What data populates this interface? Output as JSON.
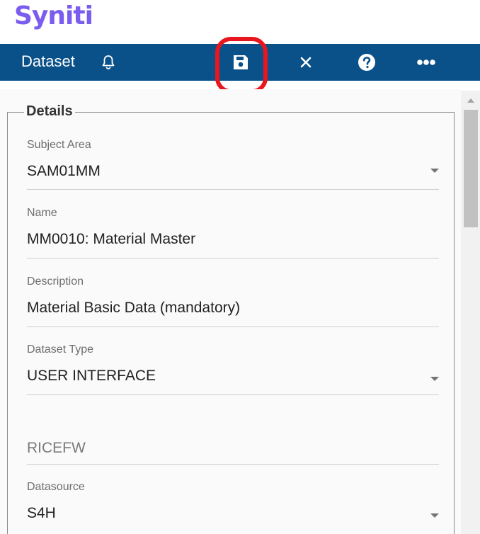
{
  "app": {
    "logo_text": "Syniti",
    "logo_color": "#7b5cf0"
  },
  "toolbar": {
    "title": "Dataset",
    "background": "#0a5189",
    "icons": [
      "bell-icon",
      "save-icon",
      "close-icon",
      "help-icon",
      "more-icon"
    ],
    "highlight_color": "#e8161e"
  },
  "details": {
    "legend": "Details",
    "fields": [
      {
        "label": "Subject Area",
        "value": "SAM01MM",
        "type": "select"
      },
      {
        "label": "Name",
        "value": "MM0010: Material Master",
        "type": "text"
      },
      {
        "label": "Description",
        "value": "Material Basic Data (mandatory)",
        "type": "text"
      },
      {
        "label": "Dataset Type",
        "value": "USER INTERFACE",
        "type": "select"
      },
      {
        "placeholder": "RICEFW",
        "type": "text"
      },
      {
        "label": "Datasource",
        "value": "S4H",
        "type": "select"
      }
    ]
  }
}
